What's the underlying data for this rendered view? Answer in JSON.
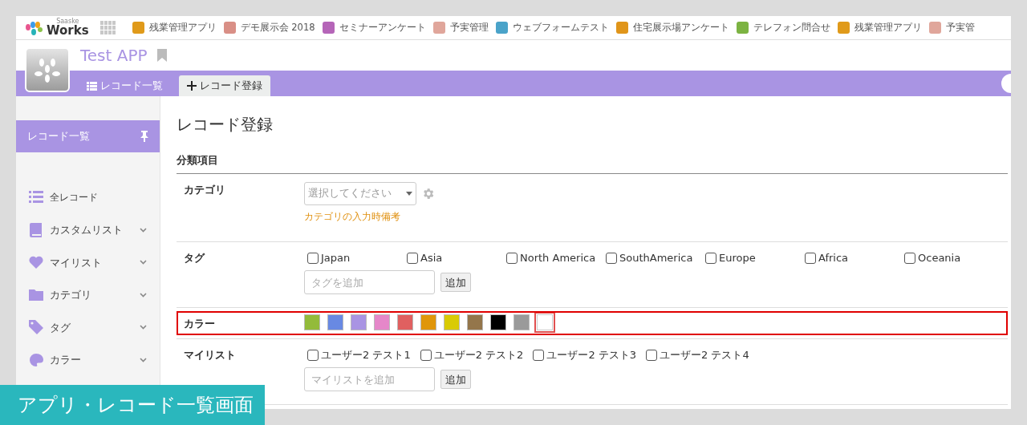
{
  "top_bar": {
    "logo_small": "Saaske",
    "logo": "Works",
    "apps": [
      {
        "label": "残業管理アプリ",
        "color": "#e09a1a"
      },
      {
        "label": "デモ展示会 2018",
        "color": "#d98f86"
      },
      {
        "label": "セミナーアンケート",
        "color": "#b565b8"
      },
      {
        "label": "予実管理",
        "color": "#e0a69b"
      },
      {
        "label": "ウェブフォームテスト",
        "color": "#4aa3c9"
      },
      {
        "label": "住宅展示場アンケート",
        "color": "#e0951a"
      },
      {
        "label": "テレフォン問合せ",
        "color": "#7cb342"
      },
      {
        "label": "残業管理アプリ",
        "color": "#e09a1a"
      },
      {
        "label": "予実管",
        "color": "#e0a69b"
      }
    ]
  },
  "app": {
    "title": "Test APP",
    "tabs": [
      {
        "label": "レコード一覧",
        "selected": false
      },
      {
        "label": "レコード登録",
        "selected": true
      }
    ]
  },
  "sidebar": {
    "pinned": {
      "label": "レコード一覧"
    },
    "items": [
      {
        "label": "全レコード",
        "expandable": false
      },
      {
        "label": "カスタムリスト",
        "expandable": true
      },
      {
        "label": "マイリスト",
        "expandable": true
      },
      {
        "label": "カテゴリ",
        "expandable": true
      },
      {
        "label": "タグ",
        "expandable": true
      },
      {
        "label": "カラー",
        "expandable": true
      }
    ]
  },
  "form": {
    "title": "レコード登録",
    "section": "分類項目",
    "fields": [
      {
        "kind": "select",
        "label": "カテゴリ",
        "placeholder": "選択してください",
        "note": "カテゴリの入力時備考",
        "highlighted": false
      },
      {
        "kind": "check_grid",
        "label": "タグ",
        "options": [
          {
            "label": "Japan",
            "checked": false
          },
          {
            "label": "Asia",
            "checked": false
          },
          {
            "label": "North America",
            "checked": false
          },
          {
            "label": "SouthAmerica",
            "checked": false
          },
          {
            "label": "Europe",
            "checked": false
          },
          {
            "label": "Africa",
            "checked": false
          },
          {
            "label": "Oceania",
            "checked": false
          }
        ],
        "add_placeholder": "タグを追加",
        "add_button": "追加",
        "highlighted": false
      },
      {
        "kind": "colors",
        "label": "カラー",
        "swatches": [
          {
            "color": "#93bb3a",
            "selected": false
          },
          {
            "color": "#6889e3",
            "selected": false
          },
          {
            "color": "#a994e3",
            "selected": false
          },
          {
            "color": "#e587c9",
            "selected": false
          },
          {
            "color": "#e06060",
            "selected": false
          },
          {
            "color": "#e0960a",
            "selected": false
          },
          {
            "color": "#d9cb04",
            "selected": false
          },
          {
            "color": "#94764b",
            "selected": false
          },
          {
            "color": "#000000",
            "selected": false
          },
          {
            "color": "#9a9a9a",
            "selected": false
          },
          {
            "color": "#ffffff",
            "selected": true
          }
        ],
        "highlighted": true
      },
      {
        "kind": "check_row",
        "label": "マイリスト",
        "options": [
          {
            "label": "ユーザー2 テスト1",
            "checked": false
          },
          {
            "label": "ユーザー2 テスト2",
            "checked": false
          },
          {
            "label": "ユーザー2 テスト3",
            "checked": false
          },
          {
            "label": "ユーザー2 テスト4",
            "checked": false
          }
        ],
        "add_placeholder": "マイリストを追加",
        "add_button": "追加",
        "highlighted": false
      }
    ]
  },
  "caption": "アプリ・レコード一覧画面"
}
